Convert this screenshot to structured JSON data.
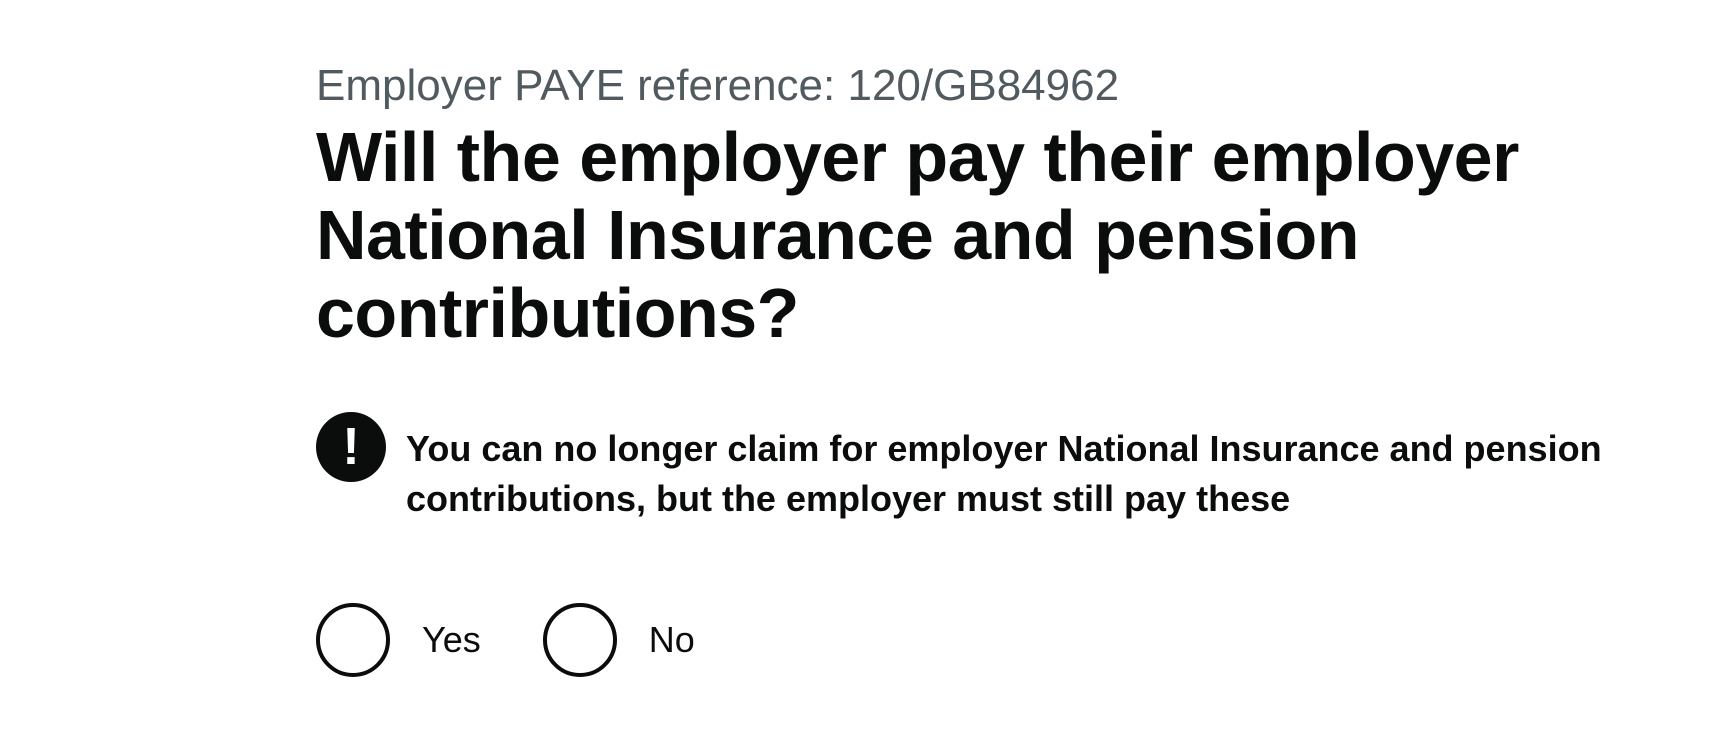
{
  "caption": "Employer PAYE reference: 120/GB84962",
  "heading": "Will the employer pay their employer National Insurance and pension contributions?",
  "warning": {
    "icon": "exclamation-icon",
    "icon_glyph": "!",
    "text": "You can no longer claim for employer National Insurance and pension contributions, but the employer must still pay these"
  },
  "radios": {
    "selected": null,
    "options": [
      {
        "label": "Yes"
      },
      {
        "label": "No"
      }
    ]
  },
  "colors": {
    "text": "#0b0c0c",
    "secondary_text": "#505a5f",
    "background": "#ffffff"
  }
}
